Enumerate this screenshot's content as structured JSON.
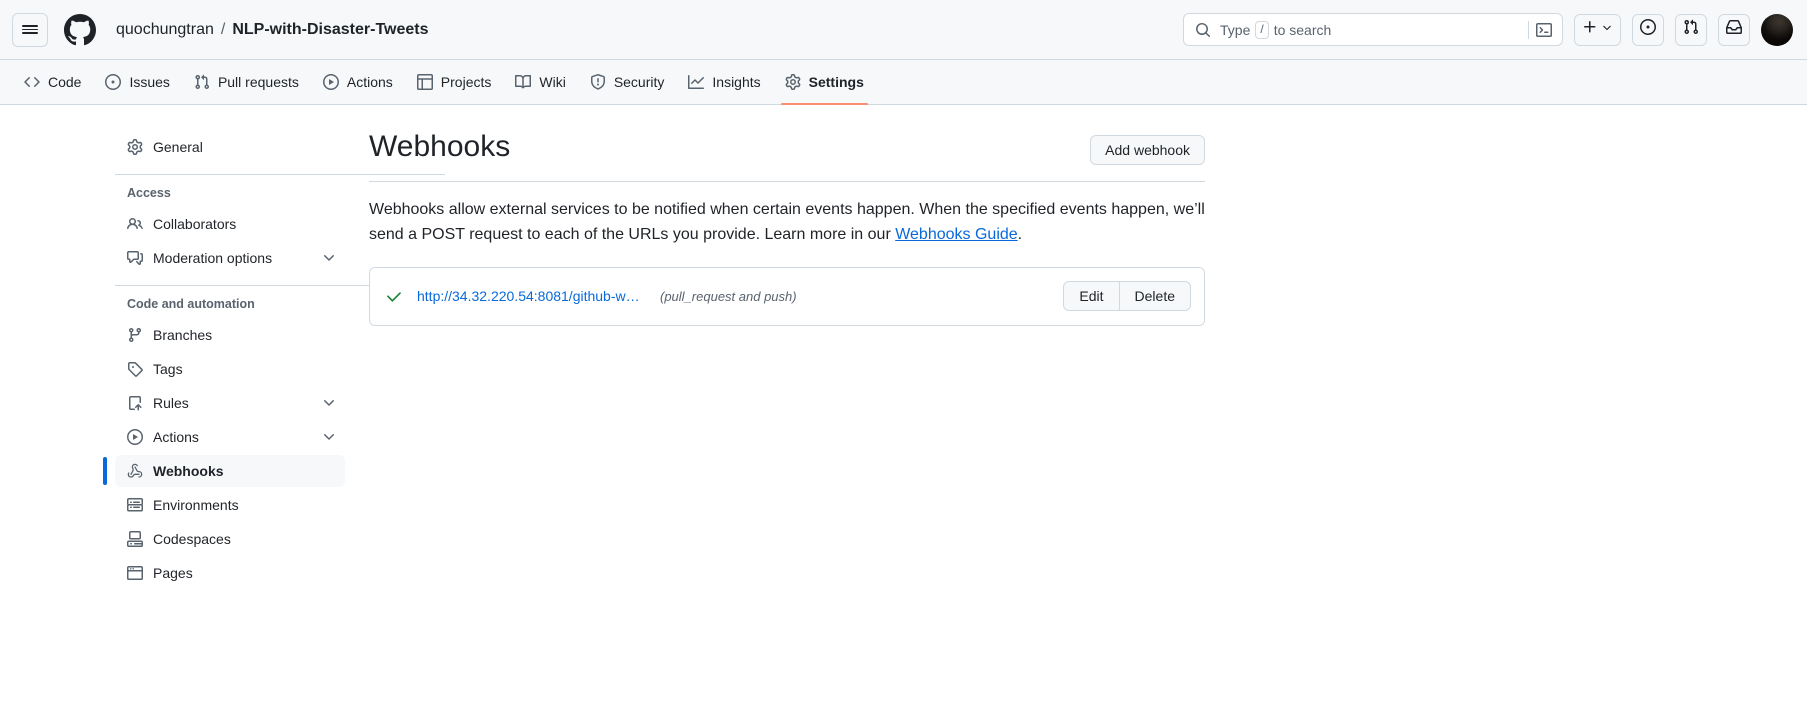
{
  "header": {
    "menu_icon": "hamburger-menu-icon",
    "logo_icon": "github-logo-icon",
    "owner": "quochungtran",
    "separator": "/",
    "repo": "NLP-with-Disaster-Tweets",
    "search": {
      "icon": "search-icon",
      "placeholder_prefix": "Type",
      "shortcut_key": "/",
      "placeholder_suffix": "to search",
      "terminal_icon": "terminal-icon"
    },
    "actions": [
      {
        "name": "create-new-menu",
        "icon": "plus-icon",
        "chevron": "chevron-down-icon"
      },
      {
        "name": "issues-shortcut",
        "icon": "issue-opened-icon"
      },
      {
        "name": "pull-requests-shortcut",
        "icon": "git-pull-request-icon"
      },
      {
        "name": "notifications-inbox",
        "icon": "inbox-icon"
      },
      {
        "name": "user-avatar",
        "icon": "avatar-image"
      }
    ]
  },
  "repo_nav": {
    "tabs": [
      {
        "label": "Code",
        "icon": "code-icon",
        "active": false
      },
      {
        "label": "Issues",
        "icon": "issue-opened-icon",
        "active": false
      },
      {
        "label": "Pull requests",
        "icon": "git-pull-request-icon",
        "active": false
      },
      {
        "label": "Actions",
        "icon": "play-icon",
        "active": false
      },
      {
        "label": "Projects",
        "icon": "table-icon",
        "active": false
      },
      {
        "label": "Wiki",
        "icon": "book-icon",
        "active": false
      },
      {
        "label": "Security",
        "icon": "shield-icon",
        "active": false
      },
      {
        "label": "Insights",
        "icon": "graph-icon",
        "active": false
      },
      {
        "label": "Settings",
        "icon": "gear-icon",
        "active": true
      }
    ]
  },
  "sidebar": {
    "top_items": [
      {
        "label": "General",
        "icon": "gear-icon",
        "active": false,
        "chevron": false
      }
    ],
    "groups": [
      {
        "title": "Access",
        "items": [
          {
            "label": "Collaborators",
            "icon": "people-icon",
            "active": false,
            "chevron": false
          },
          {
            "label": "Moderation options",
            "icon": "comment-discussion-icon",
            "active": false,
            "chevron": true
          }
        ]
      },
      {
        "title": "Code and automation",
        "items": [
          {
            "label": "Branches",
            "icon": "git-branch-icon",
            "active": false,
            "chevron": false
          },
          {
            "label": "Tags",
            "icon": "tag-icon",
            "active": false,
            "chevron": false
          },
          {
            "label": "Rules",
            "icon": "rules-icon",
            "active": false,
            "chevron": true
          },
          {
            "label": "Actions",
            "icon": "play-icon",
            "active": false,
            "chevron": true
          },
          {
            "label": "Webhooks",
            "icon": "webhook-icon",
            "active": true,
            "chevron": false
          },
          {
            "label": "Environments",
            "icon": "server-icon",
            "active": false,
            "chevron": false
          },
          {
            "label": "Codespaces",
            "icon": "codespaces-icon",
            "active": false,
            "chevron": false
          },
          {
            "label": "Pages",
            "icon": "browser-icon",
            "active": false,
            "chevron": false
          }
        ]
      }
    ]
  },
  "main": {
    "title": "Webhooks",
    "add_button": "Add webhook",
    "description_part1": "Webhooks allow external services to be notified when certain events happen. When the specified events happen, we’ll send a POST request to each of the URLs you provide. Learn more in our ",
    "description_link": "Webhooks Guide",
    "description_part2": ".",
    "webhooks": [
      {
        "status_icon": "check-icon",
        "url": "http://34.32.220.54:8081/github-we…",
        "events": "(pull_request and push)",
        "edit_label": "Edit",
        "delete_label": "Delete"
      }
    ]
  },
  "colors": {
    "accent": "#0969da",
    "active_tab_underline": "#fd8c73",
    "success": "#1a7f37",
    "border": "#d1d9e0",
    "canvas_subtle": "#f6f8fa",
    "muted_text": "#59636e"
  }
}
